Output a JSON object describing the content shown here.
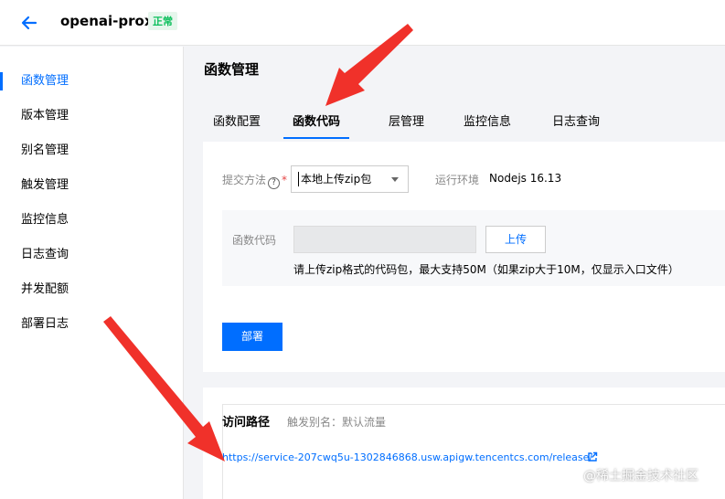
{
  "header": {
    "title": "openai-proxy",
    "status": "正常",
    "status_color": "#0abf5b"
  },
  "sidebar": {
    "items": [
      {
        "label": "函数管理",
        "active": true
      },
      {
        "label": "版本管理"
      },
      {
        "label": "别名管理"
      },
      {
        "label": "触发管理"
      },
      {
        "label": "监控信息"
      },
      {
        "label": "日志查询"
      },
      {
        "label": "并发配额"
      },
      {
        "label": "部署日志"
      }
    ]
  },
  "main": {
    "title": "函数管理",
    "tabs": [
      {
        "label": "函数配置"
      },
      {
        "label": "函数代码",
        "active": true
      },
      {
        "label": "层管理"
      },
      {
        "label": "监控信息"
      },
      {
        "label": "日志查询"
      }
    ],
    "submit_method": {
      "label": "提交方法",
      "help_icon": "?",
      "required_mark": "*",
      "value": "本地上传zip包"
    },
    "runtime": {
      "label": "运行环境",
      "value": "Nodejs 16.13"
    },
    "function_code": {
      "label": "函数代码",
      "upload_label": "上传",
      "hint": "请上传zip格式的代码包，最大支持50M（如果zip大于10M，仅显示入口文件）"
    },
    "deploy_label": "部署",
    "access": {
      "title": "访问路径",
      "trigger_alias": "触发别名：默认流量",
      "url": "https://service-207cwq5u-1302846868.usw.apigw.tencentcs.com/release/"
    }
  },
  "watermark": "@稀土掘金技术社区",
  "colors": {
    "accent": "#006eff",
    "annotation_arrow": "#f0312a"
  }
}
